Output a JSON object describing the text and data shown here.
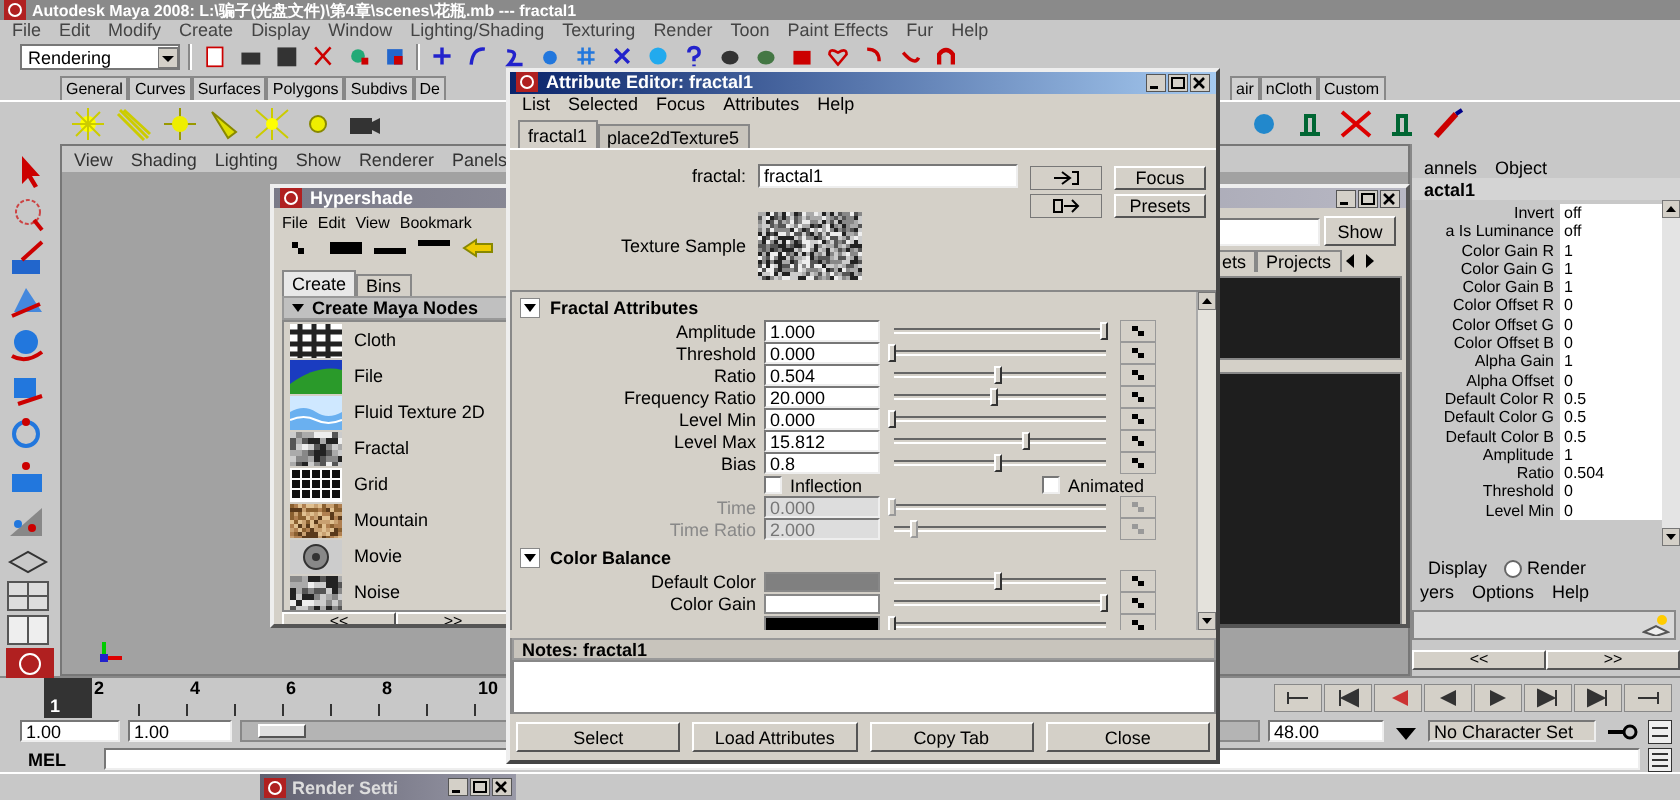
{
  "main_window": {
    "title": "Autodesk Maya 2008: L:\\骗子(光盘文件)\\第4章\\scenes\\花瓶.mb  ---  fractal1",
    "menus": [
      "File",
      "Edit",
      "Modify",
      "Create",
      "Display",
      "Window",
      "Lighting/Shading",
      "Texturing",
      "Render",
      "Toon",
      "Paint Effects",
      "Fur",
      "Help"
    ],
    "mode": "Rendering",
    "shelf_tabs_left": [
      "General",
      "Curves",
      "Surfaces",
      "Polygons",
      "Subdivs",
      "De"
    ],
    "shelf_tabs_right": [
      "air",
      "nCloth",
      "Custom"
    ],
    "panel_menus": [
      "View",
      "Shading",
      "Lighting",
      "Show",
      "Renderer",
      "Panels"
    ],
    "timeline": {
      "current_frame": "1",
      "level": 0,
      "ticks": [
        "2",
        "4",
        "6",
        "8",
        "10"
      ]
    },
    "range": {
      "start": "1.00",
      "playback_start": "1.00",
      "level": 0,
      "end": "48.00",
      "character_set": "No Character Set"
    },
    "command_line": {
      "label": "MEL"
    },
    "minimized_windows": [
      {
        "title": "Render Setti"
      }
    ]
  },
  "hypershade": {
    "title": "Hypershade",
    "menus": [
      "File",
      "Edit",
      "View",
      "Bookmark"
    ],
    "tabs": [
      {
        "label": "Create",
        "selected": true
      },
      {
        "label": "Bins",
        "selected": false
      }
    ],
    "section": "Create Maya Nodes",
    "nodes": [
      {
        "label": "Cloth",
        "kind": "cloth"
      },
      {
        "label": "File",
        "kind": "file"
      },
      {
        "label": "Fluid Texture 2D",
        "kind": "fluid"
      },
      {
        "label": "Fractal",
        "kind": "fractal"
      },
      {
        "label": "Grid",
        "kind": "grid"
      },
      {
        "label": "Mountain",
        "kind": "mountain"
      },
      {
        "label": "Movie",
        "kind": "movie"
      },
      {
        "label": "Noise",
        "kind": "noise"
      }
    ],
    "nav": [
      "<<",
      ">>"
    ],
    "show_button": "Show",
    "right_tabs": [
      "ets",
      "Projects"
    ]
  },
  "attribute_editor": {
    "title": "Attribute Editor: fractal1",
    "menus": [
      "List",
      "Selected",
      "Focus",
      "Attributes",
      "Help"
    ],
    "tabs": [
      {
        "label": "fractal1",
        "selected": true
      },
      {
        "label": "place2dTexture5",
        "selected": false
      }
    ],
    "node_label": "fractal:",
    "node_name": "fractal1",
    "buttons": [
      "Focus",
      "Presets"
    ],
    "sample_label": "Texture Sample",
    "sections": [
      {
        "title": "Fractal Attributes",
        "expanded": true,
        "rows": [
          {
            "kind": "slider",
            "label": "Amplitude",
            "value": "1.000",
            "level": 1,
            "disabled": false
          },
          {
            "kind": "slider",
            "label": "Threshold",
            "value": "0.000",
            "level": 0,
            "disabled": false
          },
          {
            "kind": "slider",
            "label": "Ratio",
            "value": "0.504",
            "level": 0.5,
            "disabled": false
          },
          {
            "kind": "slider",
            "label": "Frequency Ratio",
            "value": "20.000",
            "level": 0.48,
            "disabled": false
          },
          {
            "kind": "slider",
            "label": "Level Min",
            "value": "0.000",
            "level": 0,
            "disabled": false
          },
          {
            "kind": "slider",
            "label": "Level Max",
            "value": "15.812",
            "level": 0.63,
            "disabled": false
          },
          {
            "kind": "slider",
            "label": "Bias",
            "value": "0.8",
            "level": 0.5,
            "disabled": false
          },
          {
            "kind": "checkboxes",
            "items": [
              {
                "label": "Inflection",
                "checked": false
              },
              {
                "label": "Animated",
                "checked": false
              }
            ]
          },
          {
            "kind": "slider",
            "label": "Time",
            "value": "0.000",
            "level": 0,
            "disabled": true
          },
          {
            "kind": "slider",
            "label": "Time Ratio",
            "value": "2.000",
            "level": 0.1,
            "disabled": true
          }
        ]
      },
      {
        "title": "Color Balance",
        "expanded": true,
        "rows": [
          {
            "kind": "color",
            "label": "Default Color",
            "color": "#808080",
            "level": 0.5
          },
          {
            "kind": "color",
            "label": "Color Gain",
            "color": "#ffffff",
            "level": 1
          },
          {
            "kind": "color",
            "color": "#000000",
            "level": 0
          }
        ]
      }
    ],
    "notes_label": "Notes:  fractal1",
    "bottom_buttons": [
      "Select",
      "Load Attributes",
      "Copy Tab",
      "Close"
    ]
  },
  "channel_box": {
    "menus": [
      "annels",
      "Object"
    ],
    "node": "actal1",
    "rows": [
      {
        "name": "Invert",
        "value": "off"
      },
      {
        "name": "a Is Luminance",
        "value": "off"
      },
      {
        "name": "Color Gain R",
        "value": "1"
      },
      {
        "name": "Color Gain G",
        "value": "1"
      },
      {
        "name": "Color Gain B",
        "value": "1"
      },
      {
        "name": "Color Offset R",
        "value": "0"
      },
      {
        "name": "Color Offset G",
        "value": "0"
      },
      {
        "name": "Color Offset B",
        "value": "0"
      },
      {
        "name": "Alpha Gain",
        "value": "1"
      },
      {
        "name": "Alpha Offset",
        "value": "0"
      },
      {
        "name": "Default Color R",
        "value": "0.5"
      },
      {
        "name": "Default Color G",
        "value": "0.5"
      },
      {
        "name": "Default Color B",
        "value": "0.5"
      },
      {
        "name": "Amplitude",
        "value": "1"
      },
      {
        "name": "Ratio",
        "value": "0.504"
      },
      {
        "name": "Threshold",
        "value": "0"
      },
      {
        "name": "Level Min",
        "value": "0"
      }
    ],
    "layer_display": "Display",
    "layer_radio": {
      "label": "Render",
      "selected": false
    },
    "layer_menus": [
      "yers",
      "Options",
      "Help"
    ],
    "nav": [
      "<<",
      ">>"
    ]
  }
}
